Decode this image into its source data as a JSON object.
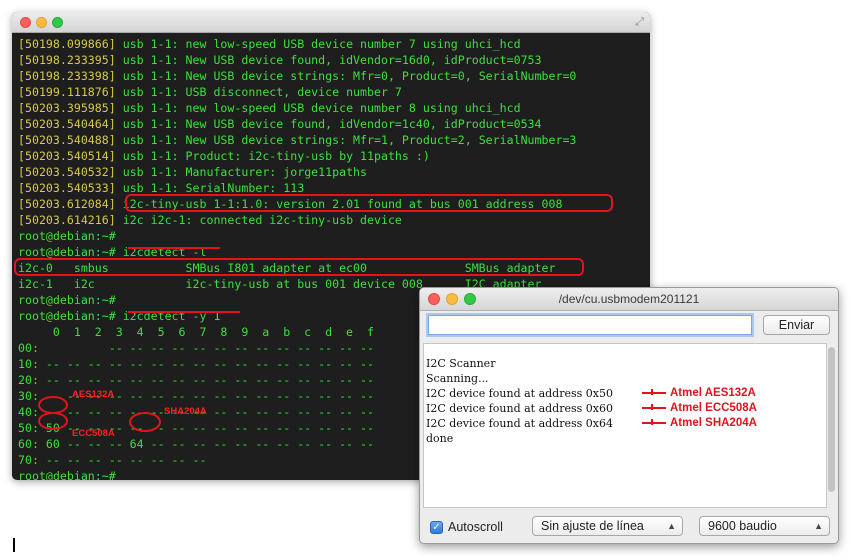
{
  "terminal": {
    "lines": [
      {
        "ts": "[50198.099866]",
        "msg": " usb 1-1: new low-speed USB device number 7 using uhci_hcd"
      },
      {
        "ts": "[50198.233395]",
        "msg": " usb 1-1: New USB device found, idVendor=16d0, idProduct=0753"
      },
      {
        "ts": "[50198.233398]",
        "msg": " usb 1-1: New USB device strings: Mfr=0, Product=0, SerialNumber=0"
      },
      {
        "ts": "[50199.111876]",
        "msg": " usb 1-1: USB disconnect, device number 7"
      },
      {
        "ts": "[50203.395985]",
        "msg": " usb 1-1: new low-speed USB device number 8 using uhci_hcd"
      },
      {
        "ts": "[50203.540464]",
        "msg": " usb 1-1: New USB device found, idVendor=1c40, idProduct=0534"
      },
      {
        "ts": "[50203.540488]",
        "msg": " usb 1-1: New USB device strings: Mfr=1, Product=2, SerialNumber=3"
      },
      {
        "ts": "[50203.540514]",
        "msg": " usb 1-1: Product: i2c-tiny-usb by 11paths :)"
      },
      {
        "ts": "[50203.540532]",
        "msg": " usb 1-1: Manufacturer: jorge11paths"
      },
      {
        "ts": "[50203.540533]",
        "msg": " usb 1-1: SerialNumber: 113"
      },
      {
        "ts": "[50203.612084]",
        "msg": " i2c-tiny-usb 1-1:1.0: version 2.01 found at bus 001 address 008"
      },
      {
        "ts": "[50203.614216]",
        "msg": " i2c i2c-1: connected i2c-tiny-usb device"
      },
      {
        "ts": "",
        "msg": "root@debian:~#"
      },
      {
        "ts": "",
        "msg": "root@debian:~# i2cdetect -l"
      },
      {
        "ts": "",
        "msg": "i2c-0   smbus           SMBus I801 adapter at ec00              SMBus adapter"
      },
      {
        "ts": "",
        "msg": "i2c-1   i2c             i2c-tiny-usb at bus 001 device 008      I2C adapter"
      },
      {
        "ts": "",
        "msg": "root@debian:~#"
      },
      {
        "ts": "",
        "msg": "root@debian:~# i2cdetect -y 1"
      },
      {
        "ts": "",
        "msg": "     0  1  2  3  4  5  6  7  8  9  a  b  c  d  e  f"
      },
      {
        "ts": "",
        "msg": "00:          -- -- -- -- -- -- -- -- -- -- -- -- --"
      },
      {
        "ts": "",
        "msg": "10: -- -- -- -- -- -- -- -- -- -- -- -- -- -- -- --"
      },
      {
        "ts": "",
        "msg": "20: -- -- -- -- -- -- -- -- -- -- -- -- -- -- -- --"
      },
      {
        "ts": "",
        "msg": "30: -- -- -- -- -- -- -- -- -- -- -- -- -- -- -- --"
      },
      {
        "ts": "",
        "msg": "40: -- -- -- -- -- -- -- -- -- -- -- -- -- -- -- --"
      },
      {
        "ts": "",
        "msg": "50: 50 -- -- -- -- -- -- -- -- -- -- -- -- -- -- --"
      },
      {
        "ts": "",
        "msg": "60: 60 -- -- -- 64 -- -- -- -- -- -- -- -- -- -- --"
      },
      {
        "ts": "",
        "msg": "70: -- -- -- -- -- -- -- --"
      },
      {
        "ts": "",
        "msg": "root@debian:~#"
      },
      {
        "ts": "",
        "msg": "root@debian:~#"
      },
      {
        "ts": "",
        "msg": "root@debian:~#"
      }
    ],
    "annotations": {
      "aes": "AES132A",
      "ecc": "ECC508A",
      "sha": "SHA204A"
    },
    "colors": {
      "text": "#3ce03c",
      "timestamp": "#d8c84a",
      "highlight": "#e0141c",
      "background": "#1e1e1e"
    }
  },
  "serial_monitor": {
    "title": "/dev/cu.usbmodem201121",
    "input_value": "",
    "send_label": "Enviar",
    "output": [
      "I2C Scanner",
      "Scanning...",
      "I2C device found at address 0x50",
      "I2C device found at address 0x60",
      "I2C device found at address 0x64",
      "done"
    ],
    "chip_labels": [
      "Atmel AES132A",
      "Atmel ECC508A",
      "Atmel SHA204A"
    ],
    "autoscroll_label": "Autoscroll",
    "autoscroll_checked": true,
    "line_ending": "Sin ajuste de línea",
    "baud": "9600 baudio"
  }
}
